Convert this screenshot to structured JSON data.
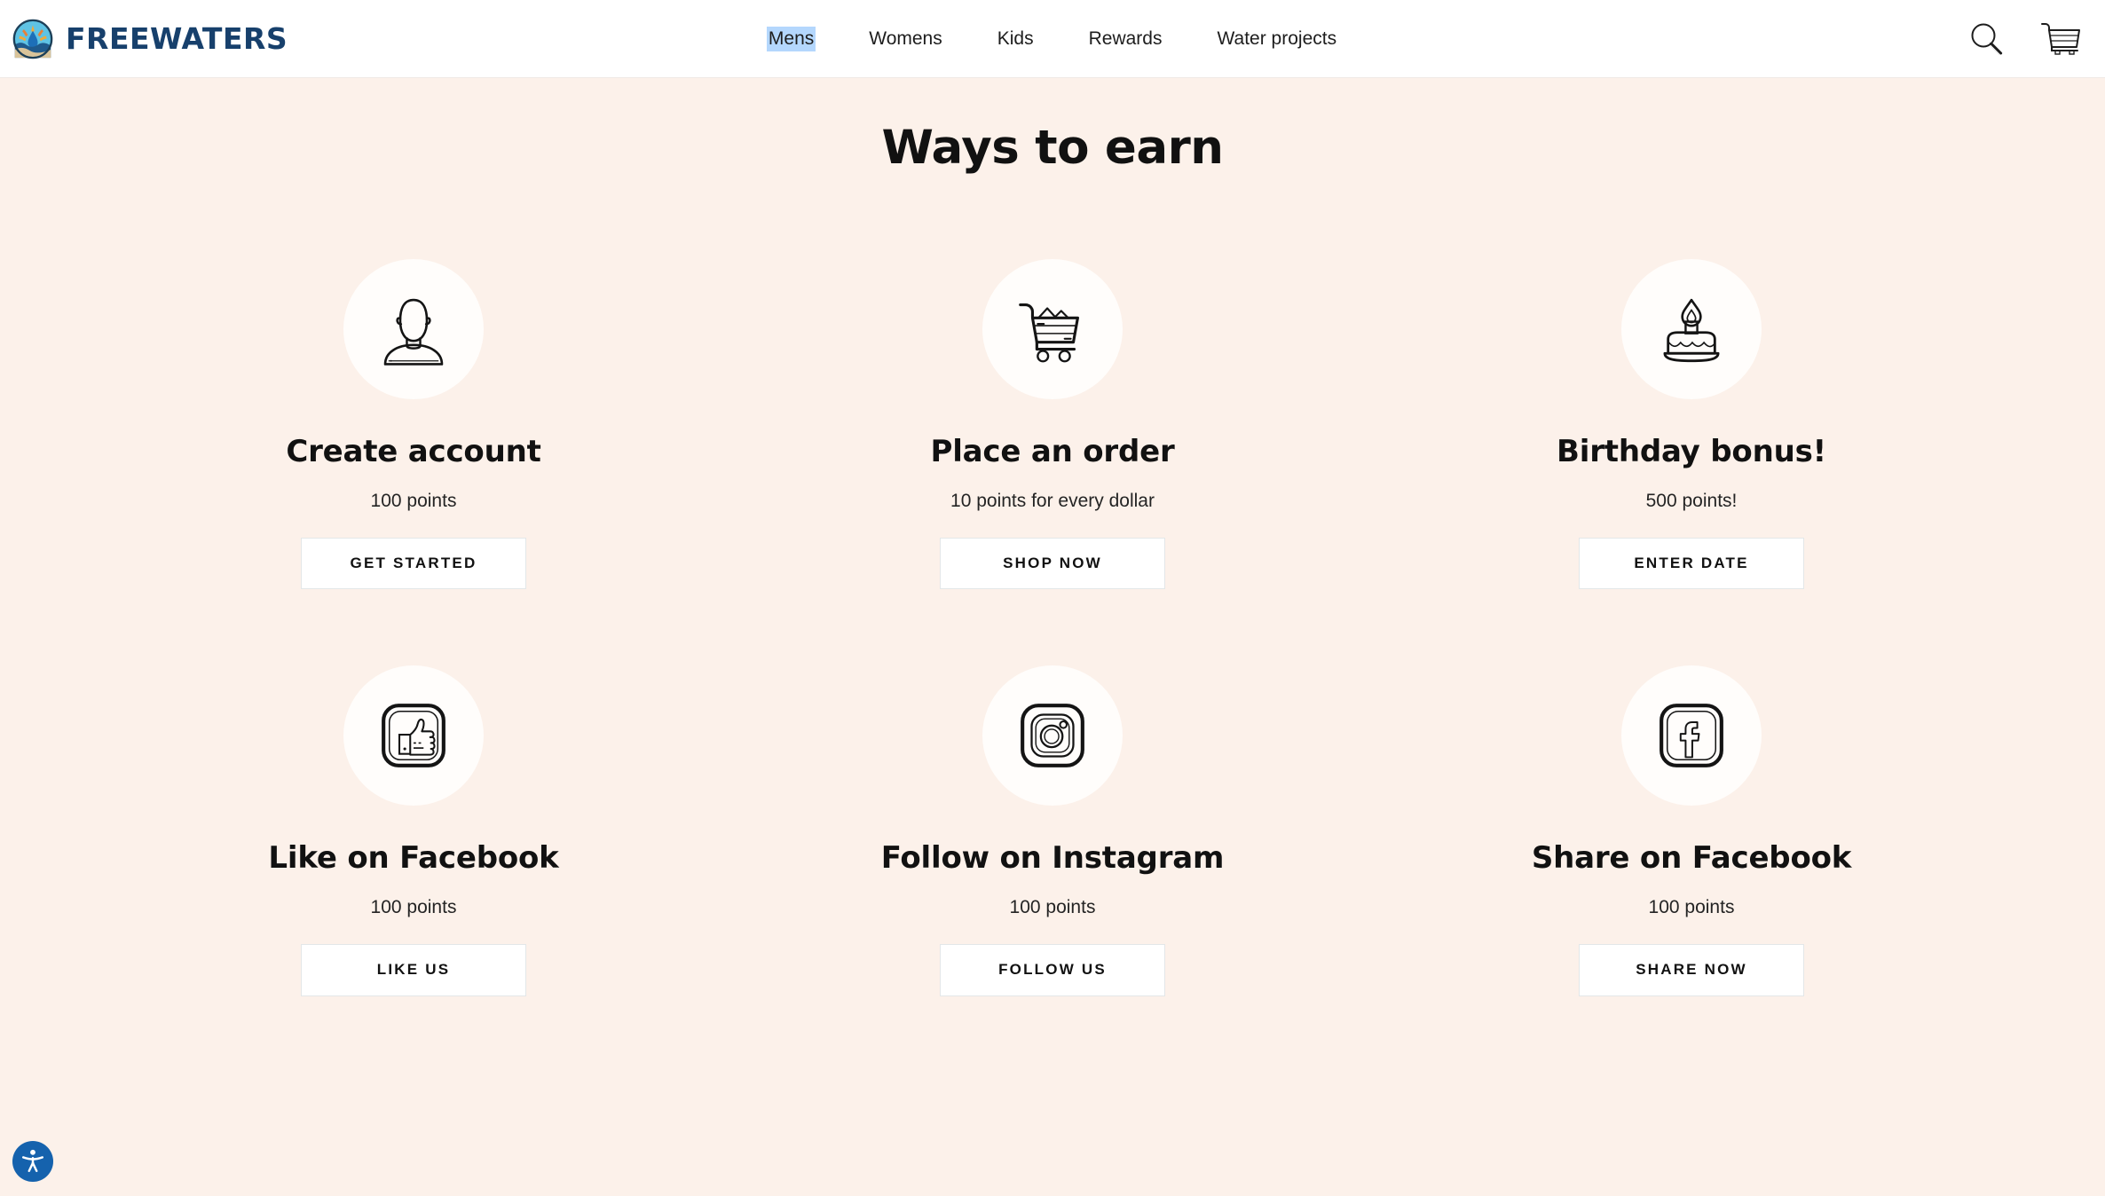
{
  "theme": {
    "page_background": "#fcf1ea",
    "header_background": "#ffffff",
    "brand_color": "#17406c",
    "selection_highlight": "#b4d7fd",
    "icon_circle": "#fffdfb",
    "button_background": "#ffffff",
    "button_border": "#e3e7e8",
    "accessibility_blue": "#1562ad"
  },
  "header": {
    "brand_name": "FREEWATERS",
    "brand_logo_icon": "freewaters-globe-logo-icon",
    "nav": [
      {
        "label": "Mens",
        "selected": true
      },
      {
        "label": "Womens",
        "selected": false
      },
      {
        "label": "Kids",
        "selected": false
      },
      {
        "label": "Rewards",
        "selected": false
      },
      {
        "label": "Water projects",
        "selected": false
      }
    ],
    "actions": [
      {
        "name": "search-icon",
        "label": "Search"
      },
      {
        "name": "cart-icon",
        "label": "Cart"
      }
    ]
  },
  "main": {
    "title": "Ways to earn",
    "cards": [
      {
        "icon": "person-account-icon",
        "title": "Create account",
        "points": "100 points",
        "cta": "GET STARTED"
      },
      {
        "icon": "shopping-cart-icon",
        "title": "Place an order",
        "points": "10 points for every dollar",
        "cta": "SHOP NOW"
      },
      {
        "icon": "birthday-cake-icon",
        "title": "Birthday bonus!",
        "points": "500 points!",
        "cta": "ENTER DATE"
      },
      {
        "icon": "thumbs-up-facebook-icon",
        "title": "Like on Facebook",
        "points": "100 points",
        "cta": "LIKE US"
      },
      {
        "icon": "instagram-icon",
        "title": "Follow on Instagram",
        "points": "100 points",
        "cta": "FOLLOW US"
      },
      {
        "icon": "facebook-icon",
        "title": "Share on Facebook",
        "points": "100 points",
        "cta": "SHARE NOW"
      }
    ]
  },
  "accessibility_widget": {
    "icon": "accessibility-person-icon",
    "label": "Accessibility"
  }
}
